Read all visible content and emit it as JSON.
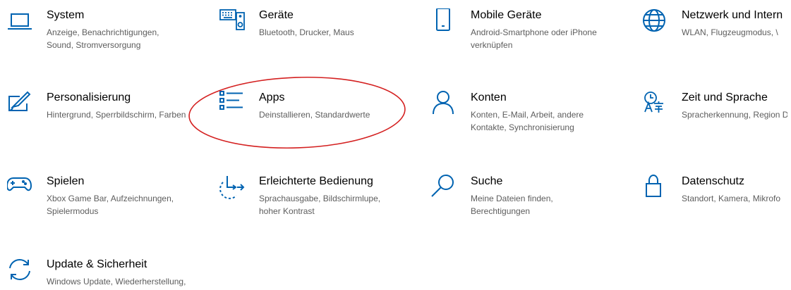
{
  "accent_color": "#0063b1",
  "annotation_color": "#d42020",
  "tiles": [
    {
      "id": "system",
      "icon": "laptop-icon",
      "title": "System",
      "description": "Anzeige, Benachrichtigungen, Sound, Stromversorgung"
    },
    {
      "id": "devices",
      "icon": "keyboard-speaker-icon",
      "title": "Geräte",
      "description": "Bluetooth, Drucker, Maus"
    },
    {
      "id": "phone",
      "icon": "phone-icon",
      "title": "Mobile Geräte",
      "description": "Android-Smartphone oder iPhone verknüpfen"
    },
    {
      "id": "network",
      "icon": "globe-icon",
      "title": "Netzwerk und Intern",
      "description": "WLAN, Flugzeugmodus, \\"
    },
    {
      "id": "personalization",
      "icon": "paint-brush-icon",
      "title": "Personalisierung",
      "description": "Hintergrund, Sperrbildschirm, Farben"
    },
    {
      "id": "apps",
      "icon": "apps-list-icon",
      "title": "Apps",
      "description": "Deinstallieren, Standardwerte"
    },
    {
      "id": "accounts",
      "icon": "person-icon",
      "title": "Konten",
      "description": "Konten, E-Mail, Arbeit, andere Kontakte, Synchronisierung"
    },
    {
      "id": "time",
      "icon": "time-language-icon",
      "title": "Zeit und Sprache",
      "description": "Spracherkennung, Region Datum"
    },
    {
      "id": "gaming",
      "icon": "gamepad-icon",
      "title": "Spielen",
      "description": "Xbox Game Bar, Aufzeichnungen, Spielermodus"
    },
    {
      "id": "ease",
      "icon": "ease-of-access-icon",
      "title": "Erleichterte Bedienung",
      "description": "Sprachausgabe, Bildschirmlupe, hoher Kontrast"
    },
    {
      "id": "search",
      "icon": "search-icon",
      "title": "Suche",
      "description": "Meine Dateien finden, Berechtigungen"
    },
    {
      "id": "privacy",
      "icon": "lock-icon",
      "title": "Datenschutz",
      "description": "Standort, Kamera, Mikrofo"
    },
    {
      "id": "update",
      "icon": "sync-icon",
      "title": "Update & Sicherheit",
      "description": "Windows Update, Wiederherstellung, Sicherung"
    }
  ]
}
